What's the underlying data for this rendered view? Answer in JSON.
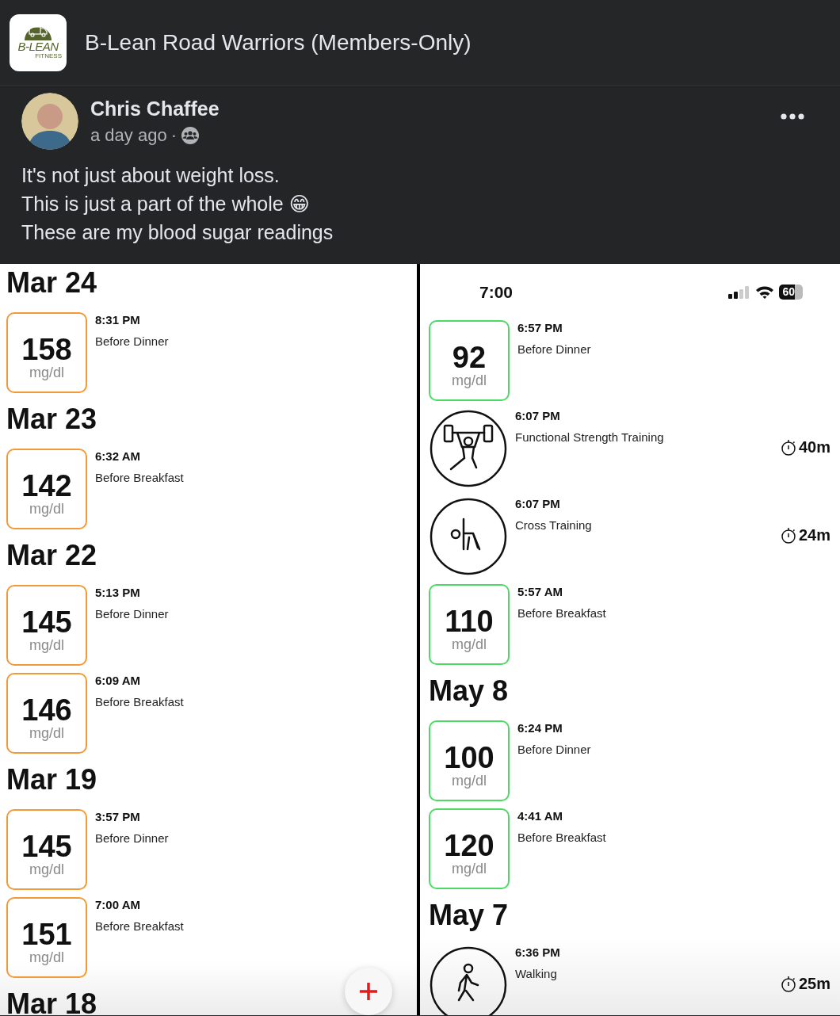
{
  "group": {
    "name": "B-Lean Road Warriors (Members-Only)",
    "logo": {
      "brand": "B-LEAN",
      "tagline": "FITNESS"
    }
  },
  "post": {
    "author": "Chris Chaffee",
    "time": "a day ago",
    "separator": "·",
    "lines": [
      "It's not just about weight loss.",
      "This is just a part of the whole 😁",
      "These are my blood sugar readings"
    ]
  },
  "screenshots": [
    {
      "entries": [
        {
          "kind": "date",
          "label": "Mar 24"
        },
        {
          "kind": "reading",
          "value": "158",
          "unit": "mg/dl",
          "time": "8:31 PM",
          "label": "Before Dinner",
          "color": "#f29a3a"
        },
        {
          "kind": "date",
          "label": "Mar 23"
        },
        {
          "kind": "reading",
          "value": "142",
          "unit": "mg/dl",
          "time": "6:32 AM",
          "label": "Before Breakfast",
          "color": "#f29a3a"
        },
        {
          "kind": "date",
          "label": "Mar 22"
        },
        {
          "kind": "reading",
          "value": "145",
          "unit": "mg/dl",
          "time": "5:13 PM",
          "label": "Before Dinner",
          "color": "#f29a3a"
        },
        {
          "kind": "reading",
          "value": "146",
          "unit": "mg/dl",
          "time": "6:09 AM",
          "label": "Before Breakfast",
          "color": "#f29a3a"
        },
        {
          "kind": "date",
          "label": "Mar 19"
        },
        {
          "kind": "reading",
          "value": "145",
          "unit": "mg/dl",
          "time": "3:57 PM",
          "label": "Before Dinner",
          "color": "#f29a3a"
        },
        {
          "kind": "reading",
          "value": "151",
          "unit": "mg/dl",
          "time": "7:00 AM",
          "label": "Before Breakfast",
          "color": "#f29a3a"
        },
        {
          "kind": "date",
          "label": "Mar 18"
        }
      ]
    },
    {
      "status_bar": {
        "time": "7:00",
        "battery": "60"
      },
      "entries": [
        {
          "kind": "reading",
          "value": "92",
          "unit": "mg/dl",
          "time": "6:57 PM",
          "label": "Before Dinner",
          "color": "#4cd964"
        },
        {
          "kind": "strength",
          "time": "6:07 PM",
          "label": "Functional Strength Training",
          "duration": "40m"
        },
        {
          "kind": "cross",
          "time": "6:07 PM",
          "label": "Cross Training",
          "duration": "24m"
        },
        {
          "kind": "reading",
          "value": "110",
          "unit": "mg/dl",
          "time": "5:57 AM",
          "label": "Before Breakfast",
          "color": "#4cd964"
        },
        {
          "kind": "date",
          "label": "May 8"
        },
        {
          "kind": "reading",
          "value": "100",
          "unit": "mg/dl",
          "time": "6:24 PM",
          "label": "Before Dinner",
          "color": "#4cd964"
        },
        {
          "kind": "reading",
          "value": "120",
          "unit": "mg/dl",
          "time": "4:41 AM",
          "label": "Before Breakfast",
          "color": "#4cd964"
        },
        {
          "kind": "date",
          "label": "May 7"
        },
        {
          "kind": "walking",
          "time": "6:36 PM",
          "label": "Walking",
          "duration": "25m"
        }
      ]
    }
  ]
}
